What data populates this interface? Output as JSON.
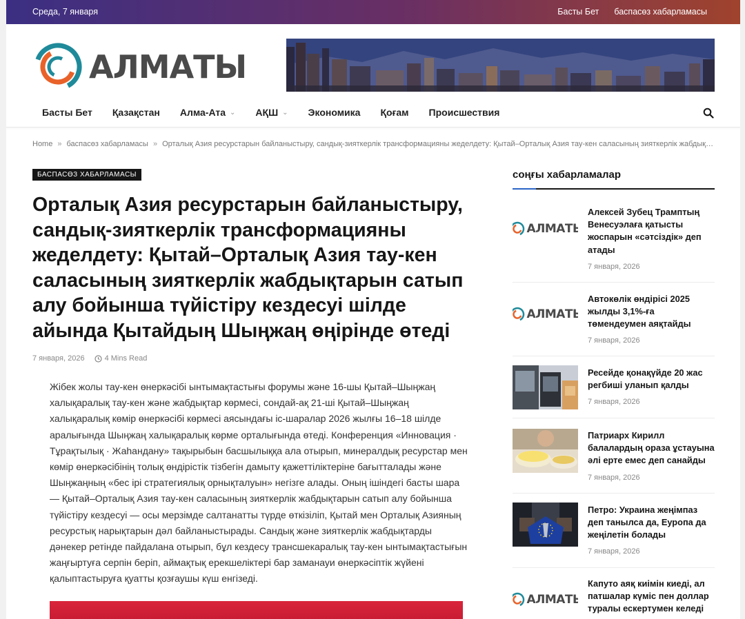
{
  "topbar": {
    "date": "Среда, 7 января",
    "links": [
      "Басты Бет",
      "баспасөз хабарламасы"
    ]
  },
  "logo": {
    "text": "АЛМАТЫ"
  },
  "nav": {
    "items": [
      {
        "label": "Басты Бет",
        "dropdown": false
      },
      {
        "label": "Қазақстан",
        "dropdown": false
      },
      {
        "label": "Алма-Ата",
        "dropdown": true
      },
      {
        "label": "АҚШ",
        "dropdown": true
      },
      {
        "label": "Экономика",
        "dropdown": false
      },
      {
        "label": "Қоғам",
        "dropdown": false
      },
      {
        "label": "Происшествия",
        "dropdown": false
      }
    ]
  },
  "breadcrumb": {
    "home": "Home",
    "category": "баспасөз хабарламасы",
    "current": "Орталық Азия ресурстарын байланыстыру, сандық-зияткерлік трансформацияны жеделдету: Қытай–Орталық Азия тау-кен саласының зияткерлік жабдықта..."
  },
  "article": {
    "category_badge": "БАСПАСӨЗ ХАБАРЛАМАСЫ",
    "title": "Орталық Азия ресурстарын байланыстыру, сандық-зияткерлік трансформацияны жеделдету: Қытай–Орталық Азия тау-кен саласының зияткерлік жабдықтарын сатып алу бойынша түйістіру кездесуі шілде айында Қытайдың Шыңжаң өңірінде өтеді",
    "date": "7 января, 2026",
    "read_time": "4 Mins Read",
    "body": "Жібек жолы тау-кен өнеркәсібі ынтымақтастығы форумы және 16-шы Қытай–Шыңжаң халықаралық тау-кен және жабдықтар көрмесі, сондай-ақ 21-ші Қытай–Шыңжаң халықаралық көмір өнеркәсібі көрмесі аясындағы іс-шаралар 2026 жылғы 16–18 шілде аралығында Шыңжаң халықаралық көрме орталығында өтеді. Конференция «Инновация · Тұрақтылық · Жаһандану» тақырыбын басшылыққа ала отырып, минералдық ресурстар мен көмір өнеркәсібінің толық өндірістік тізбегін дамыту қажеттіліктеріне бағытталады және Шыңжаңның «бес ірі стратегиялық орнықталуын» негізге алады. Оның ішіндегі басты шара — Қытай–Орталық Азия тау-кен саласының зияткерлік жабдықтарын сатып алу бойынша түйістіру кездесуі — осы мерзімде салтанатты түрде өткізіліп, Қытай мен Орталық Азияның ресурстық нарықтарын дәл байланыстырады. Сандық және зияткерлік жабдықтарды дәнекер ретінде пайдалана отырып, бұл кездесу трансшекаралық тау-кен ынтымақтастығын жаңғыртуға серпін беріп, аймақтық ерекшеліктері бар заманауи өнеркәсіптік жүйені қалыптастыруға қуатты қозғаушы күш енгізеді."
  },
  "sidebar": {
    "heading": "соңғы хабарламалар",
    "posts": [
      {
        "title": "Алексей Зубец Трамптың Венесуэлаға қатысты жоспарын «сәтсіздік» деп атады",
        "date": "7 января, 2026",
        "thumb": "logo",
        "logo_text": "АЛМАТЬ"
      },
      {
        "title": "Автокөлік өндірісі 2025 жылды 3,1%-ға төмендеумен аяқтайды",
        "date": "7 января, 2026",
        "thumb": "logo",
        "logo_text": "АЛМАТЬ"
      },
      {
        "title": "Ресейде қонақүйде 20 жас регбиші уланып қалды",
        "date": "7 января, 2026",
        "thumb": "photo-bus"
      },
      {
        "title": "Патриарх Кирилл балалардың ораза ұстауына әлі ерте емес деп санайды",
        "date": "7 января, 2026",
        "thumb": "photo-food"
      },
      {
        "title": "Петро: Украина жеңімпаз деп танылса да, Еуропа да жеңілетін болады",
        "date": "7 января, 2026",
        "thumb": "photo-eu"
      },
      {
        "title": "Капуто аяқ киімін киеді, ал патшалар күміс пен доллар туралы ескертумен келеді",
        "date": "",
        "thumb": "logo",
        "logo_text": "АЛМАТЬ"
      }
    ]
  },
  "colors": {
    "topbar_start": "#3b2f83",
    "topbar_end": "#a0432d",
    "accent_blue": "#2a64c6",
    "logo_orange": "#e8622a",
    "logo_teal": "#1f8a9a"
  }
}
